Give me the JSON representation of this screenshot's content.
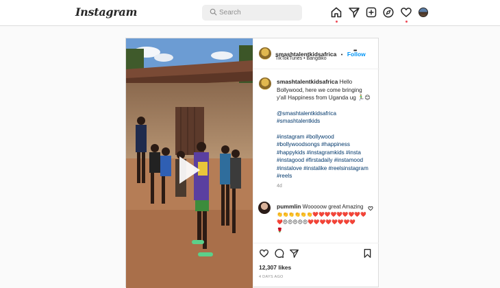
{
  "header": {
    "logo": "Instagram",
    "search_placeholder": "Search",
    "nav": [
      "home-icon",
      "direct-icon",
      "new-post-icon",
      "explore-icon",
      "activity-icon",
      "profile-avatar"
    ]
  },
  "post": {
    "username": "smashtalentkidsafrica",
    "separator": "•",
    "follow_label": "Follow",
    "location": "TikTokTunes • Bangdiko",
    "more": "•••",
    "caption_user": "smashtalentkidsafrica",
    "caption_lines": [
      "Hello",
      "Bollywood, here we come bringing",
      "y'all Happiness from Uganda ug 🏃‍♂️😊"
    ],
    "mentions": [
      "@smashtalentkidsafrica",
      "#smashtalentkids"
    ],
    "hashtags": [
      "#instagram #bollywood",
      "#bollywoodsongs #happiness",
      "#happykids #instagramkids #insta",
      "#instagood #firstadaily #instamood",
      "#instalove #instalike #reelsinstagram",
      "#reels"
    ],
    "caption_time": "4d",
    "comment": {
      "username": "pummlin",
      "text": "Wooooow great Amazing",
      "emoji_lines": [
        "👏👏👏👏👏👏❤️❤️❤️❤️❤️❤️❤️❤️❤️",
        "❤️😍😍😍😍😍❤️❤️❤️❤️❤️❤️❤️❤️",
        "🌹"
      ]
    },
    "likes": "12,307 likes",
    "posted_ago": "4 DAYS AGO"
  },
  "colors": {
    "accent": "#0095f6",
    "notification": "#ed4956",
    "hashtag": "#00376b"
  }
}
